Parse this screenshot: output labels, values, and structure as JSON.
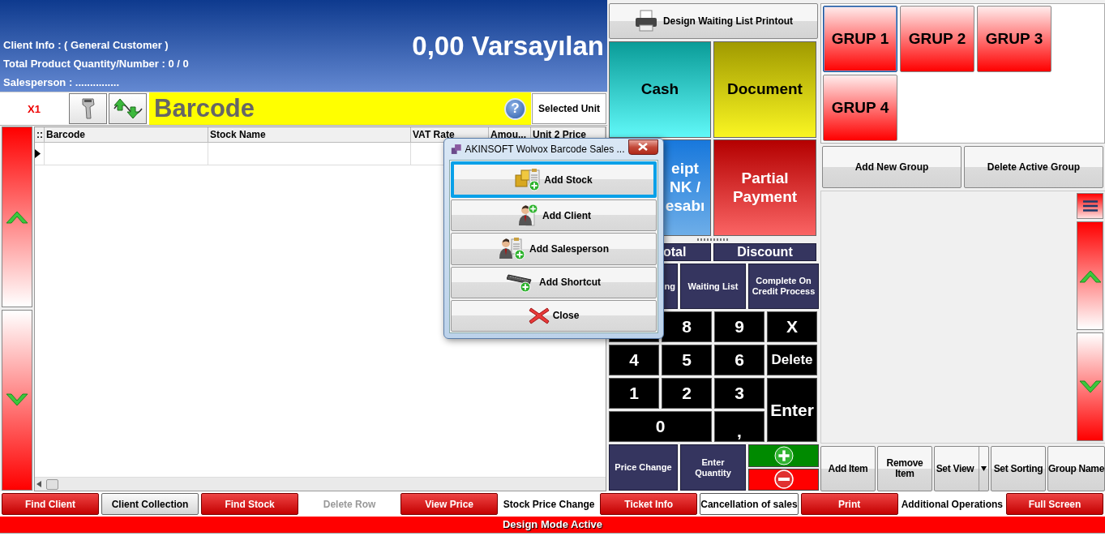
{
  "header": {
    "client_info": "Client Info : ( General Customer )",
    "total_quantity": "Total Product Quantity/Number : 0 / 0",
    "salesperson": "Salesperson : ...............",
    "amount": "0,00 Varsayılan"
  },
  "barcode_bar": {
    "multiplier": "X1",
    "placeholder": "Barcode",
    "help": "?",
    "unit_button": "Selected Unit"
  },
  "table": {
    "corner": "::",
    "columns": [
      "Barcode",
      "Stock Name",
      "VAT Rate",
      "Amou...",
      "Unit 2 Price"
    ],
    "rows": [
      {
        "current": true
      }
    ]
  },
  "print_button": "Design Waiting List Printout",
  "payment_buttons": [
    {
      "label": "Cash",
      "kind": "cyan"
    },
    {
      "label": "Document",
      "kind": "yellow"
    },
    {
      "label": "eipt\nNK /\nesabı",
      "kind": "blue"
    },
    {
      "label": "Partial\nPayment",
      "kind": "red"
    }
  ],
  "totals": [
    "otal",
    "Discount"
  ],
  "functions": [
    "ng",
    "Waiting List",
    "Complete On Credit Process"
  ],
  "keypad": [
    "8",
    "9",
    "X",
    "4",
    "5",
    "6",
    "Delete",
    "1",
    "2",
    "3",
    "Enter",
    "0",
    ","
  ],
  "quantity_buttons": [
    "Price Change",
    "Enter Quantity"
  ],
  "groups": [
    {
      "label": "GRUP 1",
      "selected": true
    },
    {
      "label": "GRUP 2",
      "selected": false
    },
    {
      "label": "GRUP 3",
      "selected": false
    },
    {
      "label": "GRUP 4",
      "selected": false
    }
  ],
  "group_actions": [
    "Add New Group",
    "Delete Active Group"
  ],
  "item_actions": [
    {
      "label": "Add Item",
      "kind": "plain"
    },
    {
      "label": "Remove Item",
      "kind": "plain"
    },
    {
      "label": "Set View",
      "kind": "split"
    },
    {
      "label": "Set Sorting",
      "kind": "plain"
    },
    {
      "label": "Group Name",
      "kind": "plain"
    }
  ],
  "toolbar": [
    {
      "label": "Find Client",
      "kind": "red",
      "disabled": false
    },
    {
      "label": "Client Collection",
      "kind": "gray",
      "disabled": false
    },
    {
      "label": "Find Stock",
      "kind": "red",
      "disabled": false
    },
    {
      "label": "Delete Row",
      "kind": "plain",
      "disabled": true
    },
    {
      "label": "View Price",
      "kind": "red",
      "disabled": false
    },
    {
      "label": "Stock Price Change",
      "kind": "plain",
      "disabled": false
    },
    {
      "label": "Ticket Info",
      "kind": "red",
      "disabled": false
    },
    {
      "label": "Cancellation of sales",
      "kind": "outlined",
      "disabled": false
    },
    {
      "label": "Print",
      "kind": "red",
      "disabled": false
    },
    {
      "label": "Additional Operations",
      "kind": "plain",
      "disabled": false
    },
    {
      "label": "Full Screen",
      "kind": "red",
      "disabled": false
    }
  ],
  "status_bar": "Design Mode Active",
  "dialog": {
    "title": "AKINSOFT Wolvox Barcode Sales ...",
    "buttons": [
      {
        "label": "Add Stock",
        "kind": "stock",
        "focused": true
      },
      {
        "label": "Add Client",
        "kind": "client",
        "focused": false
      },
      {
        "label": "Add Salesperson",
        "kind": "salesperson",
        "focused": false
      },
      {
        "label": "Add Shortcut",
        "kind": "shortcut",
        "focused": false
      },
      {
        "label": "Close",
        "kind": "close",
        "focused": false
      }
    ]
  }
}
